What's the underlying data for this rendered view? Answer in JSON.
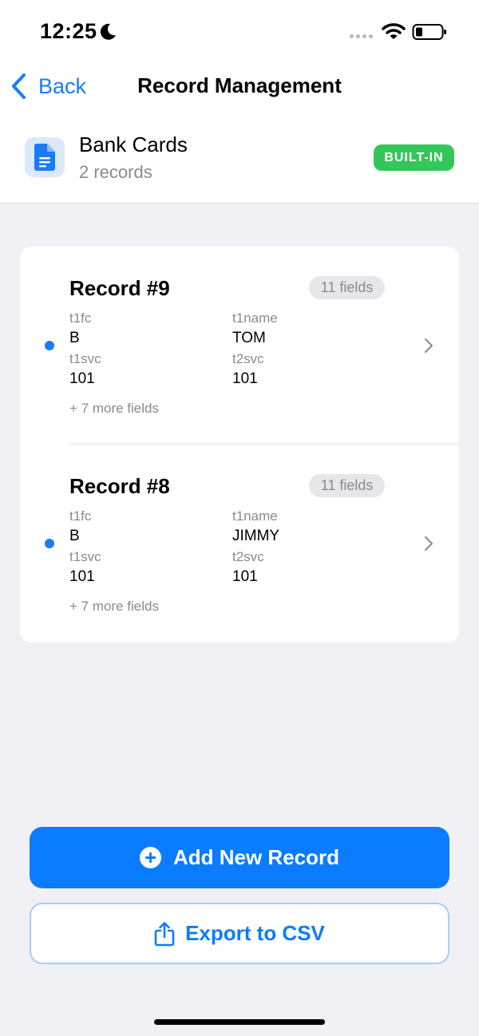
{
  "status_bar": {
    "time": "12:25",
    "icons": [
      "moon-icon",
      "signal-icon",
      "wifi-icon",
      "battery-icon"
    ]
  },
  "nav": {
    "back_label": "Back",
    "title": "Record Management"
  },
  "collection": {
    "name": "Bank Cards",
    "count": "2 records",
    "badge": "BUILT-IN",
    "icon": "document-icon"
  },
  "records": [
    {
      "title": "Record #9",
      "fields_badge": "11 fields",
      "fields": [
        {
          "label": "t1fc",
          "value": "B"
        },
        {
          "label": "t1name",
          "value": "TOM"
        },
        {
          "label": "t1svc",
          "value": "101"
        },
        {
          "label": "t2svc",
          "value": "101"
        }
      ],
      "more": "+ 7 more fields"
    },
    {
      "title": "Record #8",
      "fields_badge": "11 fields",
      "fields": [
        {
          "label": "t1fc",
          "value": "B"
        },
        {
          "label": "t1name",
          "value": "JIMMY"
        },
        {
          "label": "t1svc",
          "value": "101"
        },
        {
          "label": "t2svc",
          "value": "101"
        }
      ],
      "more": "+ 7 more fields"
    }
  ],
  "actions": {
    "add_label": "Add New Record",
    "export_label": "Export to CSV"
  },
  "colors": {
    "accent": "#0a7cff",
    "badge_green": "#33c75a",
    "background": "#f0f0f5"
  }
}
